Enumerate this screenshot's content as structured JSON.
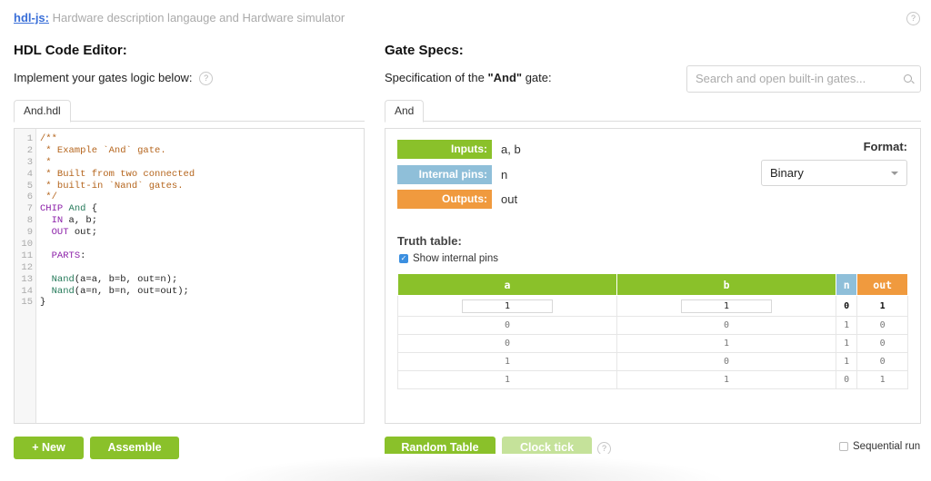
{
  "header": {
    "brand": "hdl-js:",
    "tagline": " Hardware description langauge and Hardware simulator",
    "help_icon": "question-circle-icon"
  },
  "editor_panel": {
    "title": "HDL Code Editor:",
    "subtitle": "Implement your gates logic below:",
    "tab": "And.hdl",
    "lines": [
      {
        "n": "1",
        "parts": [
          {
            "t": "/**",
            "c": "com"
          }
        ]
      },
      {
        "n": "2",
        "parts": [
          {
            "t": " * Example `And` gate.",
            "c": "com"
          }
        ]
      },
      {
        "n": "3",
        "parts": [
          {
            "t": " *",
            "c": "com"
          }
        ]
      },
      {
        "n": "4",
        "parts": [
          {
            "t": " * Built from two connected",
            "c": "com"
          }
        ]
      },
      {
        "n": "5",
        "parts": [
          {
            "t": " * built-in `Nand` gates.",
            "c": "com"
          }
        ]
      },
      {
        "n": "6",
        "parts": [
          {
            "t": " */",
            "c": "com"
          }
        ]
      },
      {
        "n": "7",
        "parts": [
          {
            "t": "CHIP",
            "c": "kw"
          },
          {
            "t": " ",
            "c": ""
          },
          {
            "t": "And",
            "c": "id"
          },
          {
            "t": " {",
            "c": ""
          }
        ]
      },
      {
        "n": "8",
        "parts": [
          {
            "t": "  ",
            "c": ""
          },
          {
            "t": "IN",
            "c": "kw"
          },
          {
            "t": " a, b;",
            "c": ""
          }
        ]
      },
      {
        "n": "9",
        "parts": [
          {
            "t": "  ",
            "c": ""
          },
          {
            "t": "OUT",
            "c": "kw"
          },
          {
            "t": " out;",
            "c": ""
          }
        ]
      },
      {
        "n": "10",
        "parts": []
      },
      {
        "n": "11",
        "parts": [
          {
            "t": "  ",
            "c": ""
          },
          {
            "t": "PARTS",
            "c": "kw"
          },
          {
            "t": ":",
            "c": ""
          }
        ]
      },
      {
        "n": "12",
        "parts": []
      },
      {
        "n": "13",
        "parts": [
          {
            "t": "  ",
            "c": ""
          },
          {
            "t": "Nand",
            "c": "id"
          },
          {
            "t": "(a=a, b=b, out=n);",
            "c": ""
          }
        ]
      },
      {
        "n": "14",
        "parts": [
          {
            "t": "  ",
            "c": ""
          },
          {
            "t": "Nand",
            "c": "id"
          },
          {
            "t": "(a=n, b=n, out=out);",
            "c": ""
          }
        ]
      },
      {
        "n": "15",
        "parts": [
          {
            "t": "}",
            "c": ""
          }
        ]
      }
    ],
    "buttons": {
      "new": "+ New",
      "assemble": "Assemble"
    }
  },
  "specs_panel": {
    "title": "Gate Specs:",
    "subtitle_pre": "Specification of the ",
    "subtitle_gate": "\"And\"",
    "subtitle_post": " gate:",
    "search_placeholder": "Search and open built-in gates...",
    "tab": "And",
    "pins": {
      "inputs_label": "Inputs:",
      "inputs": "a, b",
      "internal_label": "Internal pins:",
      "internal": "n",
      "outputs_label": "Outputs:",
      "outputs": "out"
    },
    "format_label": "Format:",
    "format_value": "Binary",
    "truth_table_label": "Truth table:",
    "show_internal_label": "Show internal pins",
    "show_internal_checked": true,
    "table": {
      "columns": [
        "a",
        "b",
        "n",
        "out"
      ],
      "column_kinds": [
        "input",
        "input",
        "internal",
        "output"
      ],
      "edit_row": [
        "1",
        "1",
        "0",
        "1"
      ],
      "rows": [
        [
          "0",
          "0",
          "1",
          "0"
        ],
        [
          "0",
          "1",
          "1",
          "0"
        ],
        [
          "1",
          "0",
          "1",
          "0"
        ],
        [
          "1",
          "1",
          "0",
          "1"
        ]
      ]
    },
    "buttons": {
      "random_table": "Random Table",
      "clock_tick": "Clock tick"
    },
    "sequential_run_label": "Sequential run",
    "sequential_run_checked": false
  },
  "colors": {
    "input": "#8ac12a",
    "internal": "#8fbfd9",
    "output": "#f09a3e",
    "button": "#8ac12a",
    "button_disabled": "#c5e29a",
    "link": "#3a6fd8"
  }
}
